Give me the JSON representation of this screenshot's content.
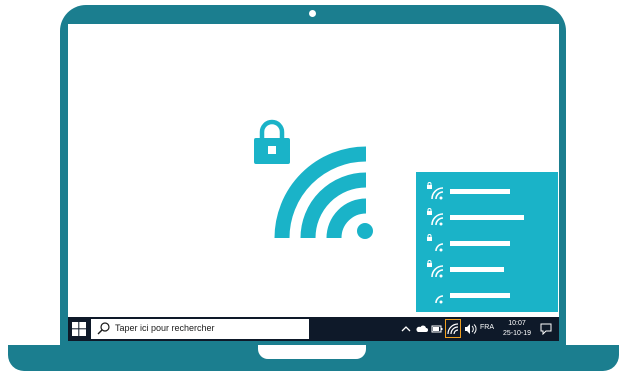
{
  "taskbar": {
    "search_placeholder": "Taper ici pour rechercher",
    "language": "FRA",
    "time": "10:07",
    "date": "25-10-19"
  },
  "wifi_panel": {
    "networks": [
      {
        "secured": true,
        "bar_width": 60
      },
      {
        "secured": true,
        "bar_width": 74
      },
      {
        "secured": true,
        "bar_width": 60
      },
      {
        "secured": true,
        "bar_width": 54
      },
      {
        "secured": false,
        "bar_width": 60
      }
    ]
  },
  "colors": {
    "laptop": "#1b7e8f",
    "accent": "#1ab3c8",
    "taskbar": "#0e1929",
    "highlight": "#f0a020"
  },
  "icons": [
    "lock-icon",
    "wifi-icon",
    "windows-logo-icon",
    "search-icon",
    "chevron-up-icon",
    "cloud-icon",
    "battery-icon",
    "wifi-tray-icon",
    "volume-icon",
    "notification-icon"
  ]
}
